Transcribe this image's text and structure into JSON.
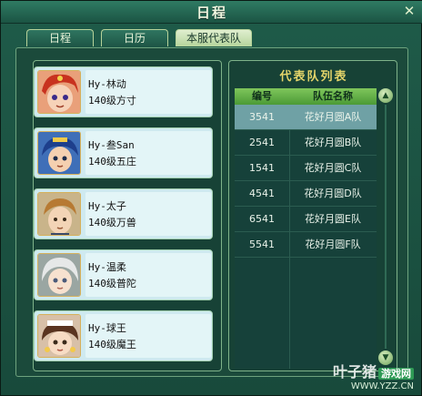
{
  "window": {
    "title": "日程"
  },
  "tabs": [
    {
      "label": "日程",
      "active": false
    },
    {
      "label": "日历",
      "active": false
    },
    {
      "label": "本服代表队",
      "active": true
    }
  ],
  "members": [
    {
      "name": "Hy-林动",
      "level": "140级方寸"
    },
    {
      "name": "Hy-叁San",
      "level": "140级五庄"
    },
    {
      "name": "Hy-太子",
      "level": "140级万兽"
    },
    {
      "name": "Hy-温柔",
      "level": "140级普陀"
    },
    {
      "name": "Hy-球王",
      "level": "140级魔王"
    }
  ],
  "team_list": {
    "title": "代表队列表",
    "headers": {
      "id": "编号",
      "name": "队伍名称"
    },
    "rows": [
      {
        "id": "3541",
        "name": "花好月圆A队",
        "selected": true
      },
      {
        "id": "2541",
        "name": "花好月圆B队",
        "selected": false
      },
      {
        "id": "1541",
        "name": "花好月圆C队",
        "selected": false
      },
      {
        "id": "4541",
        "name": "花好月圆D队",
        "selected": false
      },
      {
        "id": "6541",
        "name": "花好月圆E队",
        "selected": false
      },
      {
        "id": "5541",
        "name": "花好月圆F队",
        "selected": false
      }
    ]
  },
  "watermark": {
    "text": "叶子猪",
    "badge": "游戏网",
    "url": "WWW.YZZ.CN"
  }
}
